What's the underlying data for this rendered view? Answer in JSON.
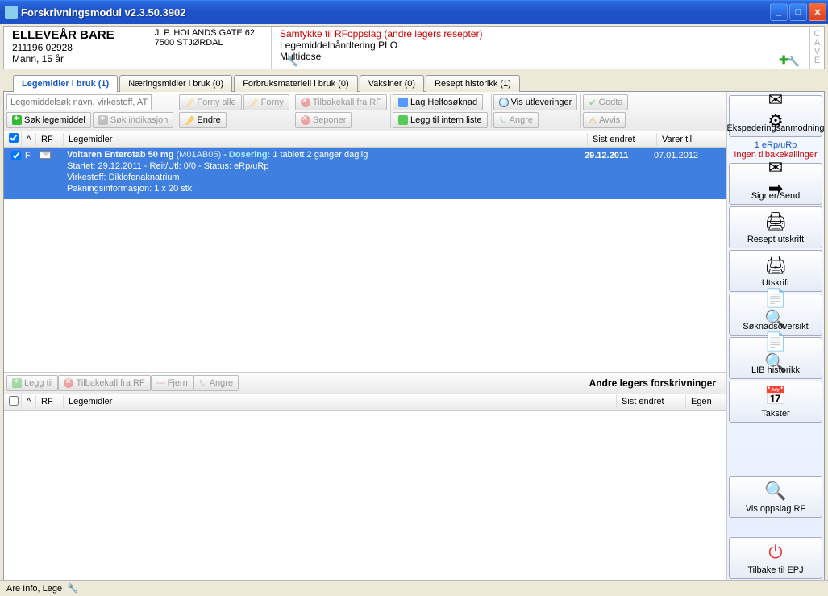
{
  "window": {
    "title": "Forskrivningsmodul v2.3.50.3902"
  },
  "patient": {
    "name": "ELLEVEÅR BARE",
    "id": "211196 02928",
    "age": "Mann, 15 år"
  },
  "address": {
    "line1": "J. P. HOLANDS GATE 62",
    "line2": "7500 STJØRDAL"
  },
  "notices": {
    "consent": "Samtykke til RFoppslag (andre legers resepter)",
    "line2": "Legemiddelhåndtering PLO",
    "line3": "Multidose"
  },
  "cave": [
    "C",
    "A",
    "V",
    "E"
  ],
  "tabs": [
    {
      "label": "Legemidler i bruk (1)",
      "active": true
    },
    {
      "label": "Næringsmidler i bruk  (0)"
    },
    {
      "label": "Forbruksmateriell i bruk (0)"
    },
    {
      "label": "Vaksiner (0)"
    },
    {
      "label": "Resept historikk (1)"
    }
  ],
  "toolbar": {
    "search_placeholder": "Legemiddelsøk navn, virkestoff, ATC",
    "sok_legemiddel": "Søk legemiddel",
    "sok_indikasjon": "Søk indikasjon",
    "forny_alle": "Forny alle",
    "forny": "Forny",
    "endre": "Endre",
    "tilbakekall_rf": "Tilbakekall fra RF",
    "seponer": "Seponer",
    "lag_helfo": "Lag Helfosøknad",
    "legg_intern": "Legg til intern liste",
    "vis_utleveringer": "Vis utleveringer",
    "angre": "Angre",
    "godta": "Godta",
    "avvis": "Avvis"
  },
  "columns": {
    "rf": "RF",
    "legemidler": "Legemidler",
    "sist_endret": "Sist endret",
    "varer_til": "Varer til",
    "egen": "Egen"
  },
  "rx": {
    "f": "F",
    "name": "Voltaren Enterotab 50 mg",
    "atc": "(M01AB05)",
    "dose_label": "Dosering:",
    "dose": "1 tablett 2 ganger daglig",
    "line2": "Startet: 29.12.2011 - Reit/Utl: 0/0 - Status: eRp/uRp",
    "line3": "Virkestoff: Diklofenaknatrium",
    "line4": "Pakningsinformasjon: 1 x 20 stk",
    "sist_endret": "29.12.2011",
    "varer_til": "07.01.2012"
  },
  "lower_toolbar": {
    "legg_til": "Legg til",
    "tilbakekall_rf": "Tilbakekall fra RF",
    "fjern": "Fjern",
    "angre": "Angre",
    "title": "Andre legers forskrivninger"
  },
  "right": {
    "eksped": "Ekspederingsanmodning",
    "info_blue": "1 eRp/uRp",
    "info_red": "Ingen tilbakekallinger",
    "signer": "Signer/Send",
    "resept_utskrift": "Resept utskrift",
    "utskrift": "Utskrift",
    "soknad": "Søknadsoversikt",
    "lib": "LIB historikk",
    "takster": "Takster",
    "vis_oppslag": "Vis oppslag RF",
    "tilbake": "Tilbake til EPJ"
  },
  "status": {
    "text": "Are Info, Lege"
  }
}
